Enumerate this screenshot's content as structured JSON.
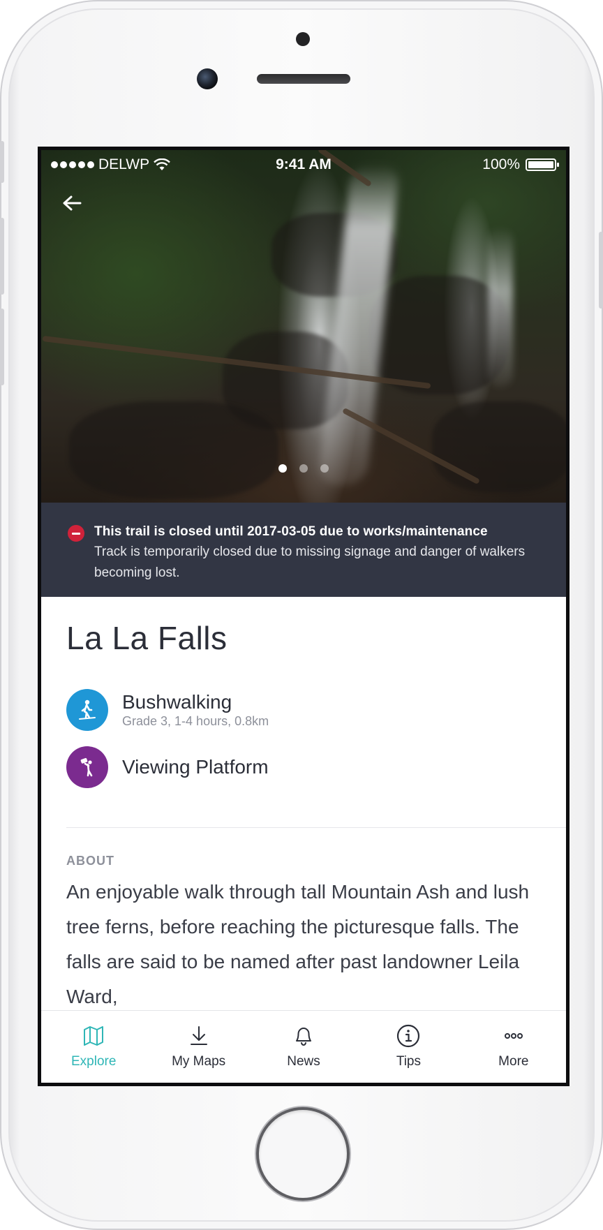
{
  "status_bar": {
    "carrier": "DELWP",
    "time": "9:41 AM",
    "battery": "100%"
  },
  "hero": {
    "pager_count": 3,
    "pager_active": 0
  },
  "alert": {
    "title": "This trail is closed until 2017-03-05 due to works/maintenance",
    "body": "Track is temporarily closed due to missing signage and danger of walkers becoming lost.",
    "color": "#d0223a"
  },
  "place": {
    "title": "La La Falls"
  },
  "activities": [
    {
      "name": "Bushwalking",
      "meta": "Grade 3, 1-4 hours, 0.8km",
      "icon": "hiker-icon",
      "color": "#1f97d6"
    },
    {
      "name": "Viewing Platform",
      "meta": "",
      "icon": "binoculars-person-icon",
      "color": "#7b2b8f"
    }
  ],
  "about": {
    "label": "ABOUT",
    "text": "An enjoyable walk through tall Mountain Ash and lush tree ferns, before reaching the picturesque falls.  The falls are said to be named after past landowner Leila Ward,"
  },
  "tabbar": {
    "accent": "#2fb6b6",
    "items": [
      {
        "label": "Explore",
        "icon": "map-icon",
        "active": true
      },
      {
        "label": "My Maps",
        "icon": "download-icon",
        "active": false
      },
      {
        "label": "News",
        "icon": "bell-icon",
        "active": false
      },
      {
        "label": "Tips",
        "icon": "info-icon",
        "active": false
      },
      {
        "label": "More",
        "icon": "more-icon",
        "active": false
      }
    ]
  }
}
